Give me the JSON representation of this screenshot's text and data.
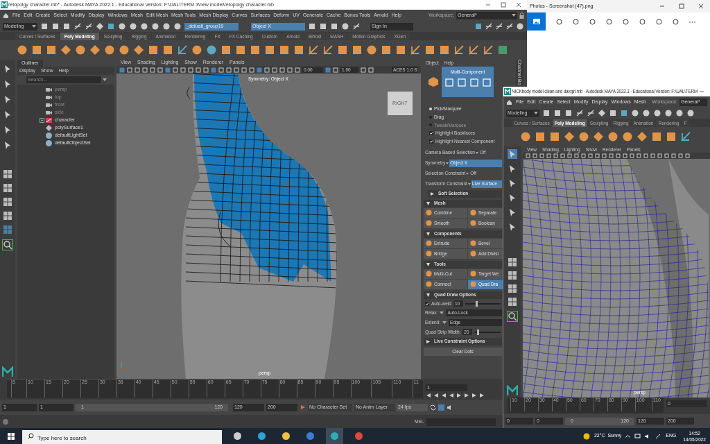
{
  "main_window": {
    "title": "retopolgy character.mb* - Autodesk MAYA 2022.1 - Educational Version: F:\\UAL\\TERM 3\\new model\\retopolgy character.mb",
    "menu": [
      "File",
      "Edit",
      "Create",
      "Select",
      "Modify",
      "Display",
      "Windows",
      "Mesh",
      "Edit Mesh",
      "Mesh Tools",
      "Mesh Display",
      "Curves",
      "Surfaces",
      "Deform",
      "UV",
      "Generate",
      "Cache",
      "Bonus Tools",
      "Arnold",
      "Help"
    ],
    "workspace_label": "Workspace:",
    "workspace": "General*",
    "status_line": {
      "menu_set": "Modeling",
      "name_field": "_defualt_group19",
      "symmetry_field": "Object X",
      "sign_in": "Sign In"
    },
    "shelf_tabs": [
      {
        "label": "Curves / Surfaces",
        "selected": false
      },
      {
        "label": "Poly Modeling",
        "selected": true
      },
      {
        "label": "Sculpting",
        "selected": false
      },
      {
        "label": "Rigging",
        "selected": false
      },
      {
        "label": "Animation",
        "selected": false
      },
      {
        "label": "Rendering",
        "selected": false
      },
      {
        "label": "FX",
        "selected": false
      },
      {
        "label": "FX Caching",
        "selected": false
      },
      {
        "label": "Custom",
        "selected": false
      },
      {
        "label": "Arnold",
        "selected": false
      },
      {
        "label": "Bifrost",
        "selected": false
      },
      {
        "label": "MASH",
        "selected": false
      },
      {
        "label": "Motion Graphics",
        "selected": false
      },
      {
        "label": "XGen",
        "selected": false
      }
    ],
    "outliner": {
      "title": "Outliner",
      "menu": [
        "Display",
        "Show",
        "Help"
      ],
      "search_placeholder": "Search...",
      "items": [
        {
          "label": "persp",
          "kind": "camera",
          "dimmed": true
        },
        {
          "label": "top",
          "kind": "camera",
          "dimmed": true
        },
        {
          "label": "front",
          "kind": "camera",
          "dimmed": true
        },
        {
          "label": "side",
          "kind": "camera",
          "dimmed": true
        },
        {
          "label": "character",
          "kind": "group",
          "dimmed": false,
          "expanded": false
        },
        {
          "label": "polySurface1",
          "kind": "mesh",
          "dimmed": false
        },
        {
          "label": "defaultLightSet",
          "kind": "set",
          "dimmed": false
        },
        {
          "label": "defaultObjectSet",
          "kind": "set",
          "dimmed": false
        }
      ]
    },
    "viewport": {
      "menu": [
        "View",
        "Shading",
        "Lighting",
        "Show",
        "Renderer",
        "Panels"
      ],
      "exposure": "0.00",
      "gamma": "1.00",
      "color_space": "ACES 1.0 S",
      "symmetry_label": "Symmetry: Object X",
      "view_cube": "RIGHT",
      "camera": "persp"
    },
    "toolkit": {
      "menu": [
        "Object",
        "Help"
      ],
      "side_tab": "Channel Bo",
      "mode": "Multi-Component",
      "pick_modes": [
        {
          "label": "Pick/Marquee",
          "selected": true,
          "disabled": false
        },
        {
          "label": "Drag",
          "selected": false,
          "disabled": false
        },
        {
          "label": "Tweak/Marquee",
          "selected": false,
          "disabled": true
        }
      ],
      "checks": [
        {
          "label": "Highlight Backfaces",
          "checked": true
        },
        {
          "label": "Highlight Nearest Component",
          "checked": true
        }
      ],
      "options": [
        {
          "label": "Camera Based Selection",
          "value": "Off",
          "highlighted": false
        },
        {
          "label": "Symmetry",
          "value": "Object X",
          "highlighted": true
        },
        {
          "label": "Selection Constraint",
          "value": "Off",
          "highlighted": false
        },
        {
          "label": "Transform Constraint",
          "value": "Live Surface",
          "highlighted": true
        }
      ],
      "soft_selection": {
        "label": "Soft Selection",
        "expanded": false
      },
      "sections": [
        {
          "label": "Mesh",
          "expanded": true,
          "buttons": [
            {
              "label": "Combine",
              "selected": false
            },
            {
              "label": "Separate",
              "selected": false
            },
            {
              "label": "Smooth",
              "selected": false
            },
            {
              "label": "Boolean",
              "selected": false
            }
          ]
        },
        {
          "label": "Components",
          "expanded": true,
          "buttons": [
            {
              "label": "Extrude",
              "selected": false
            },
            {
              "label": "Bevel",
              "selected": false
            },
            {
              "label": "Bridge",
              "selected": false
            },
            {
              "label": "Add Divisi",
              "selected": false
            }
          ]
        },
        {
          "label": "Tools",
          "expanded": true,
          "buttons": [
            {
              "label": "Multi-Cut",
              "selected": false
            },
            {
              "label": "Target We",
              "selected": false
            },
            {
              "label": "Connect",
              "selected": false
            },
            {
              "label": "Quad Dra",
              "selected": true
            }
          ]
        }
      ],
      "quad_draw": {
        "label": "Quad Draw Options",
        "expanded": true,
        "auto_weld": {
          "label": "Auto-weld",
          "checked": true,
          "value": "10",
          "level": 0.3
        },
        "relax_label": "Relax:",
        "relax": "Auto-Lock",
        "extend_label": "Extend:",
        "extend": "Edge",
        "strip_width": {
          "label": "Quad Strip Width:",
          "value": "20",
          "level": 0.1
        }
      },
      "live_constraint": {
        "label": "Live Constraint Options",
        "expanded": false
      },
      "clear_button": "Clear Dots"
    },
    "timeline": {
      "ticks": [
        "5",
        "10",
        "15",
        "20",
        "25",
        "30",
        "35",
        "40",
        "45",
        "50",
        "55",
        "60",
        "65",
        "70",
        "75",
        "80",
        "85",
        "90",
        "95",
        "100",
        "105",
        "110",
        "11"
      ],
      "current_frame": "1"
    },
    "range": {
      "start": "1",
      "playback_start": "1",
      "slider": {
        "start": "1",
        "end": "120",
        "level": 1
      },
      "playback_end": "120",
      "end": "200",
      "character_set": "No Character Set",
      "anim_layer": "No Anim Layer",
      "fps": "24 fps"
    },
    "command_line": {
      "label": "MEL"
    }
  },
  "photos_window": {
    "title": "Photos - Screenshot (47).png"
  },
  "second_window": {
    "title": "NICKbody model clean and daxgirl.mb - Autodesk MAYA 2022.1 - Educational Version: F:\\UAL\\TERM",
    "menu": [
      "File",
      "Edit",
      "Create",
      "Select",
      "Modify",
      "Display",
      "Windows",
      "Mesh"
    ],
    "workspace_label": "Workspace:",
    "workspace": "General*",
    "menu_set": "Modeling",
    "shelf_tabs": [
      {
        "label": "Curves / Surfaces",
        "selected": false
      },
      {
        "label": "Poly Modeling",
        "selected": true
      },
      {
        "label": "Sculpting",
        "selected": false
      },
      {
        "label": "Rigging",
        "selected": false
      },
      {
        "label": "Animation",
        "selected": false
      },
      {
        "label": "Rendering",
        "selected": false
      },
      {
        "label": "F",
        "selected": false
      }
    ],
    "viewport_menu": [
      "View",
      "Shading",
      "Lighting",
      "Show",
      "Renderer",
      "Panels"
    ],
    "camera": "persp",
    "timeline": {
      "ticks": [
        "10",
        "20",
        "30",
        "40",
        "50",
        "60",
        "70",
        "80",
        "90",
        "100",
        "110"
      ],
      "current_frame": "0"
    },
    "range": {
      "start": "0",
      "playback_start": "0",
      "slider": {
        "start": "0",
        "end": "120",
        "level": 1
      },
      "playback_end": "120",
      "end": "200"
    }
  },
  "taskbar": {
    "search_placeholder": "Type here to search",
    "weather": "22°C  Sunny",
    "language": "ENG",
    "time": "14:52",
    "date": "14/05/2022"
  }
}
